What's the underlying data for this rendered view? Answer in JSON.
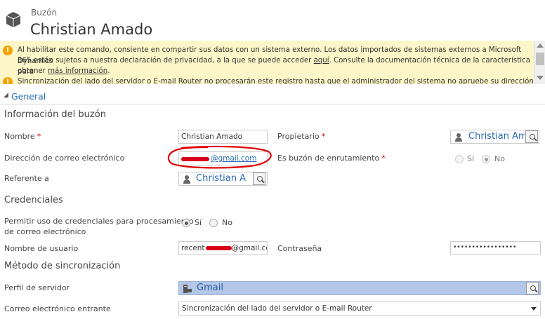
{
  "header": {
    "entity_type": "Buzón",
    "title": "Christian Amado",
    "icon": "mailbox-icon"
  },
  "notification": {
    "line1_part1": "Al habilitar este comando, consiente en compartir sus datos con un sistema externo. Los datos importados de sistemas externos a Microsoft Dynamics",
    "line2_part1": "365 están sujetos a nuestra declaración de privacidad, a la que se puede acceder ",
    "link_aqui": "aquí",
    "line2_part2": ". Consulte la documentación técnica de la característica para",
    "line3_part1": "obtener ",
    "link_mas_info": "más información",
    "line3_part2": ".",
    "line4": "Sincronización del lado del servidor o E-mail Router no procesarán este registro hasta que el administrador del sistema no apruebe su dirección de"
  },
  "section": {
    "toggle": "◢",
    "label": "General"
  },
  "groups": {
    "info": "Información del buzón",
    "credentials": "Credenciales",
    "sync": "Método de sincronización"
  },
  "fields": {
    "nombre": {
      "label": "Nombre",
      "required": "*",
      "value": "Christian Amado"
    },
    "propietario": {
      "label": "Propietario",
      "required": "*",
      "value": "Christian Am"
    },
    "email": {
      "label": "Dirección de correo electrónico",
      "domain": "@gmail.com"
    },
    "enrutamiento": {
      "label": "Es buzón de enrutamiento",
      "required": "*",
      "opt_yes": "Sí",
      "opt_no": "No",
      "selected": "No"
    },
    "referente": {
      "label": "Referente a",
      "value": "Christian A"
    },
    "permitir_cred": {
      "label_line1": "Permitir uso de credenciales para procesamiento",
      "label_line2": "de correo electrónico",
      "opt_yes": "Sí",
      "opt_no": "No",
      "selected": "Sí"
    },
    "usuario": {
      "label": "Nombre de usuario",
      "prefix": "recent",
      "suffix": "@gmail.cc"
    },
    "contrasena": {
      "label": "Contraseña",
      "value": "•••••••••••••••••"
    },
    "perfil": {
      "label": "Perfil de servidor",
      "value": "Gmail"
    },
    "entrante": {
      "label": "Correo electrónico entrante",
      "value": "Sincronización del lado del servidor o E-mail Router"
    }
  },
  "colors": {
    "accent": "#2a6cb7",
    "warning": "#f2a400",
    "notification_bg": "#fdf6c8",
    "required": "#cc0000",
    "annotation": "#e00000"
  }
}
